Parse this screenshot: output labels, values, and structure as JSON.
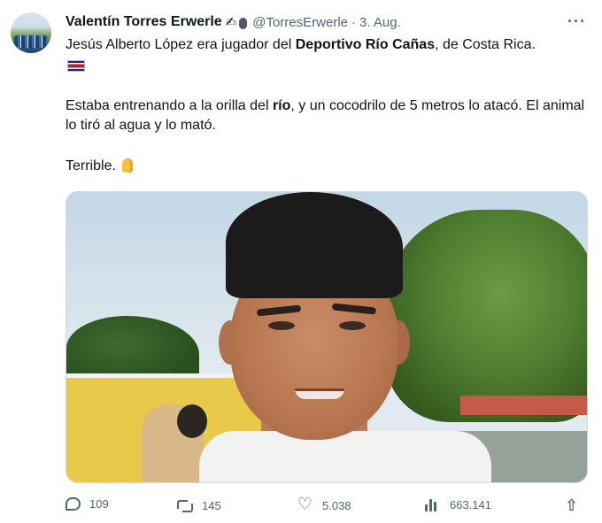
{
  "author": {
    "name": "Valentín Torres Erwerle",
    "badge_icon": "writing-hand-icon",
    "extra_icon": "microphone-icon",
    "handle": "@TorresErwerle",
    "separator": "·",
    "date": "3. Aug."
  },
  "more_icon": "more-dots-icon",
  "more_label": "···",
  "body": {
    "p1_pre": "Jesús Alberto López era jugador del ",
    "p1_bold": "Deportivo Río Cañas",
    "p1_post": ", de Costa Rica.",
    "flag_icon": "costa-rica-flag-icon",
    "p2_pre": "Estaba entrenando a la orilla del ",
    "p2_bold": "río",
    "p2_post": ", y un cocodrilo de 5 metros lo atacó. El animal lo tiró al agua y lo mató.",
    "p3": "Terrible.",
    "p3_icon": "folded-hands-icon"
  },
  "media": {
    "subject_icon": "player-portrait-photo"
  },
  "actions": {
    "replies": "109",
    "retweets": "145",
    "likes": "5.038",
    "views": "663.141",
    "reply_icon": "reply-icon",
    "retweet_icon": "retweet-icon",
    "like_icon": "heart-icon",
    "views_icon": "views-chart-icon",
    "share_icon": "share-icon"
  },
  "colors": {
    "text": "#0f1419",
    "secondary": "#536471",
    "border": "#cfd9de"
  }
}
